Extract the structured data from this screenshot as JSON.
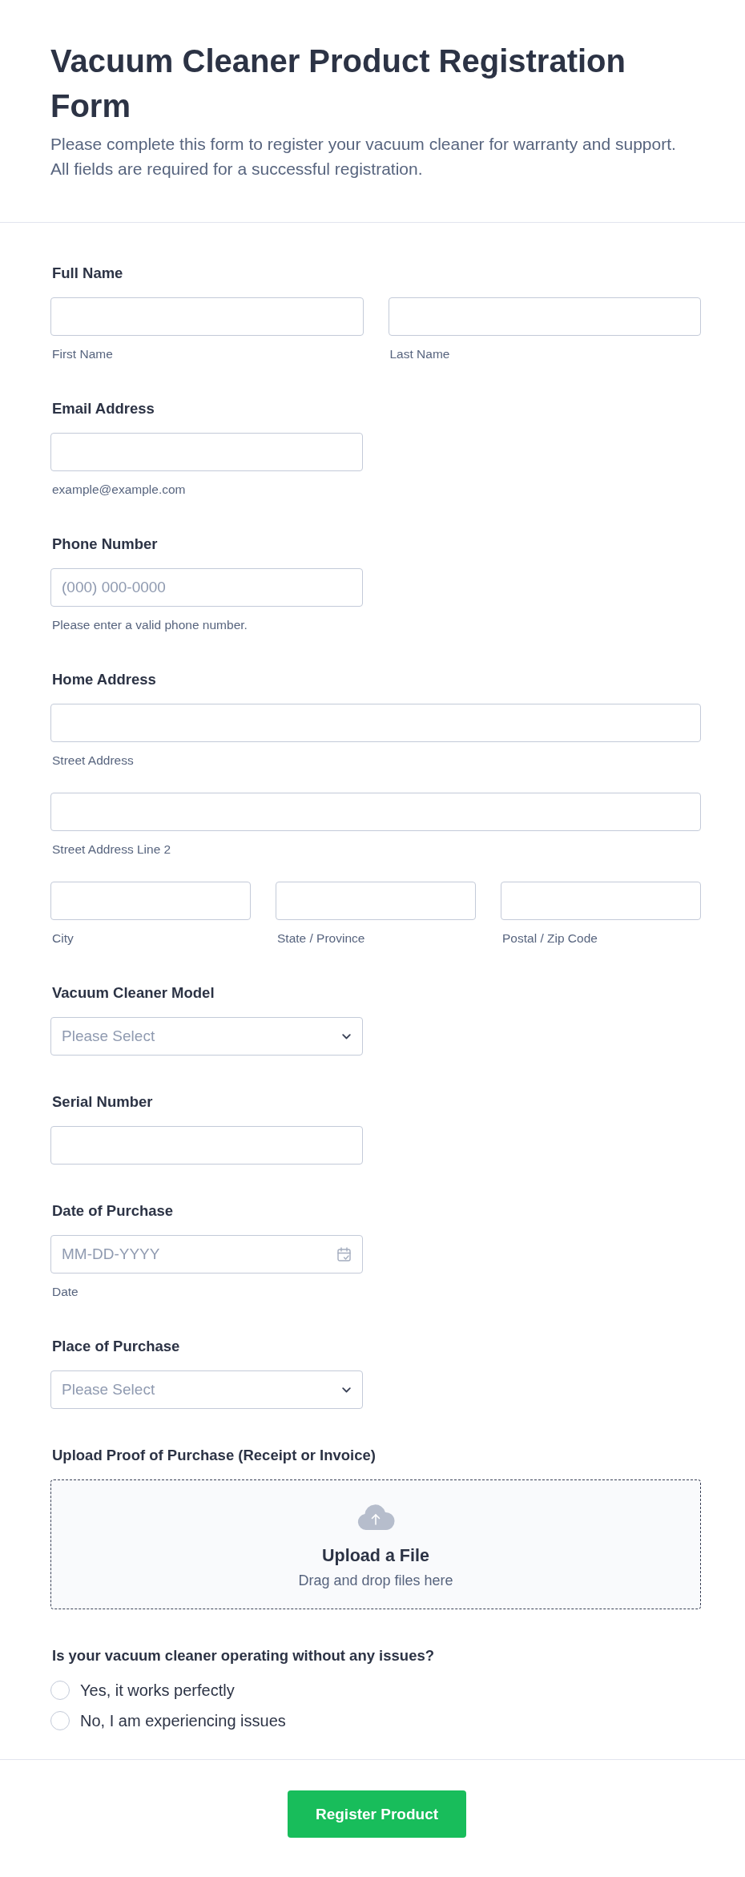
{
  "header": {
    "title": "Vacuum Cleaner Product Registration Form",
    "description": "Please complete this form to register your vacuum cleaner for warranty and support. All fields are required for a successful registration."
  },
  "form": {
    "fields": [
      {
        "kind": "composite",
        "label": "Full Name",
        "rows": [
          [
            {
              "sublabel": "First Name"
            },
            {
              "sublabel": "Last Name"
            }
          ]
        ]
      },
      {
        "kind": "text",
        "label": "Email Address",
        "sublabel": "example@example.com"
      },
      {
        "kind": "text",
        "label": "Phone Number",
        "placeholder": "(000) 000-0000",
        "sublabel": "Please enter a valid phone number."
      },
      {
        "kind": "composite",
        "label": "Home Address",
        "rows": [
          [
            {
              "sublabel": "Street Address"
            }
          ],
          [
            {
              "sublabel": "Street Address Line 2"
            }
          ],
          [
            {
              "sublabel": "City"
            },
            {
              "sublabel": "State / Province"
            },
            {
              "sublabel": "Postal / Zip Code"
            }
          ]
        ]
      },
      {
        "kind": "select",
        "label": "Vacuum Cleaner Model",
        "placeholder": "Please Select"
      },
      {
        "kind": "text",
        "label": "Serial Number"
      },
      {
        "kind": "date",
        "label": "Date of Purchase",
        "placeholder": "MM-DD-YYYY",
        "sublabel": "Date"
      },
      {
        "kind": "select",
        "label": "Place of Purchase",
        "placeholder": "Please Select"
      },
      {
        "kind": "upload",
        "label": "Upload Proof of Purchase (Receipt or Invoice)",
        "title": "Upload a File",
        "hint": "Drag and drop files here"
      },
      {
        "kind": "radio",
        "label": "Is your vacuum cleaner operating without any issues?",
        "options": [
          {
            "label": "Yes, it works perfectly",
            "selected": false
          },
          {
            "label": "No, I am experiencing issues",
            "selected": false
          }
        ]
      }
    ]
  },
  "submit_button": {
    "label": "Register Product"
  }
}
